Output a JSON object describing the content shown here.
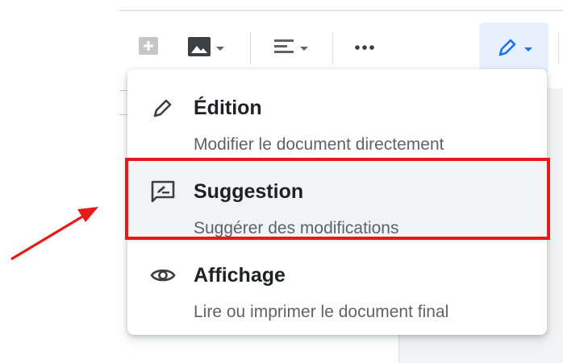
{
  "toolbar": {
    "buttons": [
      {
        "name": "add-comment",
        "icon": "add-comment-icon"
      },
      {
        "name": "insert-image",
        "icon": "image-icon"
      },
      {
        "name": "align",
        "icon": "align-left-icon"
      },
      {
        "name": "more",
        "icon": "more-horizontal-icon"
      },
      {
        "name": "editing-mode",
        "icon": "pencil-icon"
      }
    ]
  },
  "menu": {
    "items": [
      {
        "title": "Édition",
        "description": "Modifier le document directement",
        "icon": "pencil-icon",
        "selected": false
      },
      {
        "title": "Suggestion",
        "description": "Suggérer des modifications",
        "icon": "suggest-edit-icon",
        "selected": true
      },
      {
        "title": "Affichage",
        "description": "Lire ou imprimer le document final",
        "icon": "eye-icon",
        "selected": false
      }
    ]
  },
  "annotation": {
    "highlight_color": "#e8191b",
    "arrow_color": "#e8191b"
  },
  "colors": {
    "accent": "#1a73e8",
    "mode_button_bg": "#e8f0fe",
    "selected_bg": "#f1f3f4"
  }
}
